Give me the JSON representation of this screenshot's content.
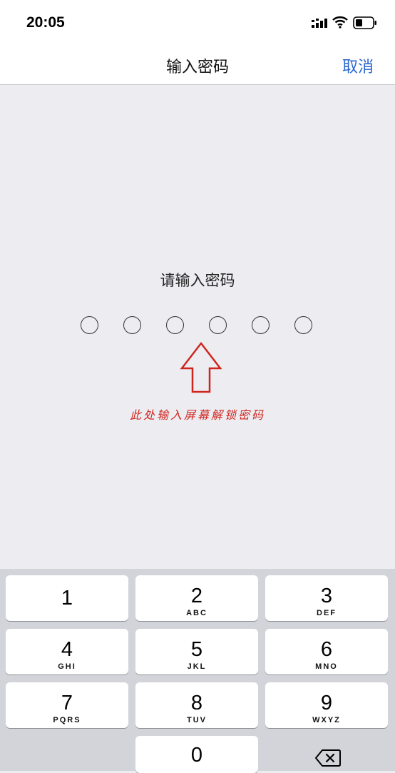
{
  "status_bar": {
    "time": "20:05"
  },
  "nav": {
    "title": "输入密码",
    "cancel_label": "取消"
  },
  "main": {
    "prompt": "请输入密码",
    "passcode_slots": 6,
    "annotation": "此处输入屏幕解锁密码"
  },
  "keypad": {
    "keys": [
      {
        "digit": "1",
        "letters": ""
      },
      {
        "digit": "2",
        "letters": "ABC"
      },
      {
        "digit": "3",
        "letters": "DEF"
      },
      {
        "digit": "4",
        "letters": "GHI"
      },
      {
        "digit": "5",
        "letters": "JKL"
      },
      {
        "digit": "6",
        "letters": "MNO"
      },
      {
        "digit": "7",
        "letters": "PQRS"
      },
      {
        "digit": "8",
        "letters": "TUV"
      },
      {
        "digit": "9",
        "letters": "WXYZ"
      },
      {
        "digit": "0",
        "letters": ""
      }
    ]
  },
  "icons": [
    "signal-icon",
    "wifi-icon",
    "battery-icon",
    "up-arrow-icon",
    "backspace-icon"
  ],
  "colors": {
    "accent": "#2b66cf",
    "annotation": "#d0251f",
    "background": "#ededf1",
    "keypad_background": "#d2d4d9"
  }
}
